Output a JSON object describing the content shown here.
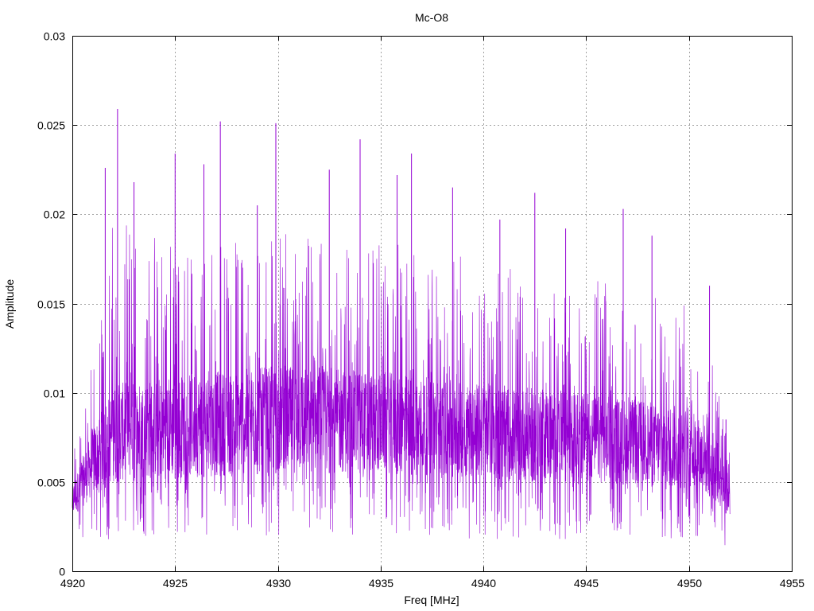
{
  "chart_data": {
    "type": "line",
    "title": "Mc-O8",
    "xlabel": "Freq [MHz]",
    "ylabel": "Amplitude",
    "xlim": [
      4920,
      4955
    ],
    "ylim": [
      0,
      0.03
    ],
    "x_ticks": [
      4920,
      4925,
      4930,
      4935,
      4940,
      4945,
      4950,
      4955
    ],
    "y_ticks": [
      0,
      0.005,
      0.01,
      0.015,
      0.02,
      0.025,
      0.03
    ],
    "grid": true,
    "legend": "none",
    "series": [
      {
        "color": "#9400d3",
        "x_range": [
          4920,
          4952
        ],
        "envelope": {
          "x": [
            4920,
            4921,
            4922,
            4925,
            4930,
            4935,
            4940,
            4945,
            4950,
            4951,
            4952
          ],
          "upper": [
            0.0065,
            0.012,
            0.02,
            0.0185,
            0.019,
            0.0185,
            0.0175,
            0.0165,
            0.015,
            0.012,
            0.009
          ],
          "lower": [
            0.001,
            0.0012,
            0.0018,
            0.002,
            0.002,
            0.002,
            0.0018,
            0.0018,
            0.0015,
            0.0012,
            0.0015
          ],
          "dense_upper": [
            0.0048,
            0.008,
            0.0105,
            0.011,
            0.0115,
            0.0112,
            0.0105,
            0.01,
            0.0092,
            0.008,
            0.006
          ],
          "dense_lower": [
            0.003,
            0.0042,
            0.005,
            0.0052,
            0.0055,
            0.0055,
            0.0052,
            0.005,
            0.0046,
            0.0042,
            0.003
          ]
        },
        "peaks": [
          {
            "x": 4922.2,
            "y": 0.0259
          },
          {
            "x": 4927.2,
            "y": 0.0252
          },
          {
            "x": 4929.9,
            "y": 0.0251
          },
          {
            "x": 4925.0,
            "y": 0.0234
          },
          {
            "x": 4926.4,
            "y": 0.0228
          },
          {
            "x": 4936.5,
            "y": 0.0234
          },
          {
            "x": 4934.0,
            "y": 0.0242
          },
          {
            "x": 4921.6,
            "y": 0.0226
          },
          {
            "x": 4932.5,
            "y": 0.0225
          },
          {
            "x": 4935.8,
            "y": 0.0222
          },
          {
            "x": 4923.0,
            "y": 0.0218
          },
          {
            "x": 4938.5,
            "y": 0.0215
          },
          {
            "x": 4942.5,
            "y": 0.0212
          },
          {
            "x": 4946.8,
            "y": 0.0203
          },
          {
            "x": 4929.0,
            "y": 0.0205
          },
          {
            "x": 4940.8,
            "y": 0.0197
          },
          {
            "x": 4944.0,
            "y": 0.0192
          },
          {
            "x": 4948.2,
            "y": 0.0188
          },
          {
            "x": 4951.0,
            "y": 0.016
          },
          {
            "x": 4951.8,
            "y": 0.0085
          }
        ]
      }
    ]
  }
}
